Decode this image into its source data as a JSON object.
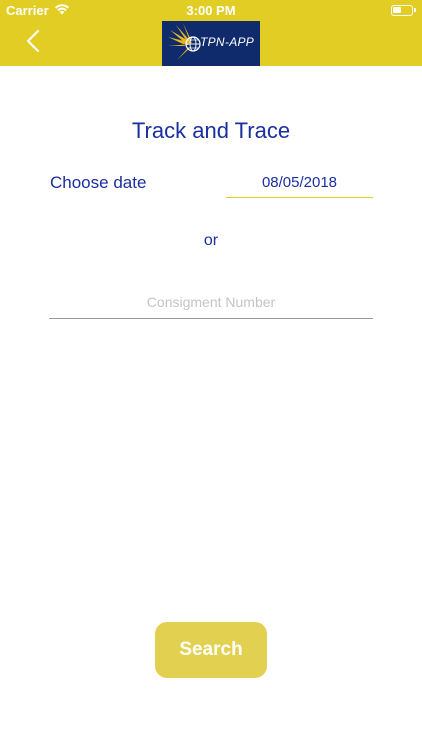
{
  "status_bar": {
    "carrier": "Carrier",
    "time": "3:00 PM"
  },
  "nav": {
    "back_icon": "chevron-left-icon",
    "logo_text": "TPN-APP",
    "logo_bg": "#0f2b6b",
    "bar_color": "#e2cd25"
  },
  "main": {
    "title": "Track and Trace",
    "date_label": "Choose date",
    "date_value": "08/05/2018",
    "or_label": "or",
    "consignment_placeholder": "Consigment Number",
    "search_label": "Search"
  },
  "colors": {
    "accent_blue": "#1a2fa0",
    "accent_yellow": "#e2cd25",
    "button_yellow": "#e2d150"
  }
}
